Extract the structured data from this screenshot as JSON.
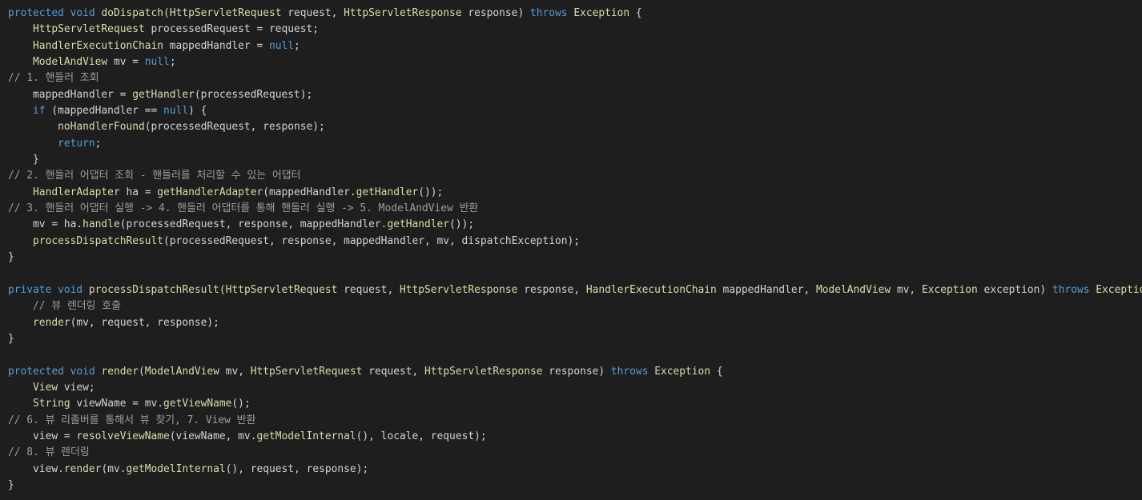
{
  "colors": {
    "background": "#1e1e1e",
    "keyword": "#569cd6",
    "type": "#dcdcaa",
    "method": "#dcdcaa",
    "text": "#d4d4d4",
    "comment": "#9e9e9e"
  },
  "code": {
    "lines": [
      [
        [
          "kw",
          "protected"
        ],
        [
          "t",
          " "
        ],
        [
          "kw",
          "void"
        ],
        [
          "t",
          " "
        ],
        [
          "fn",
          "doDispatch"
        ],
        [
          "t",
          "("
        ],
        [
          "ty",
          "HttpServletRequest"
        ],
        [
          "t",
          " request, "
        ],
        [
          "ty",
          "HttpServletResponse"
        ],
        [
          "t",
          " response) "
        ],
        [
          "kw",
          "throws"
        ],
        [
          "t",
          " "
        ],
        [
          "ty",
          "Exception"
        ],
        [
          "t",
          " {"
        ]
      ],
      [
        [
          "t",
          "    "
        ],
        [
          "ty",
          "HttpServletRequest"
        ],
        [
          "t",
          " processedRequest = request;"
        ]
      ],
      [
        [
          "t",
          "    "
        ],
        [
          "ty",
          "HandlerExecutionChain"
        ],
        [
          "t",
          " mappedHandler = "
        ],
        [
          "kw",
          "null"
        ],
        [
          "t",
          ";"
        ]
      ],
      [
        [
          "t",
          "    "
        ],
        [
          "ty",
          "ModelAndView"
        ],
        [
          "t",
          " mv = "
        ],
        [
          "kw",
          "null"
        ],
        [
          "t",
          ";"
        ]
      ],
      [
        [
          "cm",
          "// 1. 핸들러 조회"
        ]
      ],
      [
        [
          "t",
          "    mappedHandler = "
        ],
        [
          "fn",
          "getHandler"
        ],
        [
          "t",
          "(processedRequest);"
        ]
      ],
      [
        [
          "t",
          "    "
        ],
        [
          "kw",
          "if"
        ],
        [
          "t",
          " (mappedHandler == "
        ],
        [
          "kw",
          "null"
        ],
        [
          "t",
          ") {"
        ]
      ],
      [
        [
          "t",
          "        "
        ],
        [
          "fn",
          "noHandlerFound"
        ],
        [
          "t",
          "(processedRequest, response);"
        ]
      ],
      [
        [
          "t",
          "        "
        ],
        [
          "kw",
          "return"
        ],
        [
          "t",
          ";"
        ]
      ],
      [
        [
          "t",
          "    }"
        ]
      ],
      [
        [
          "cm",
          "// 2. 핸들러 어댑터 조회 - 핸들러를 처리할 수 있는 어댑터"
        ]
      ],
      [
        [
          "t",
          "    "
        ],
        [
          "ty",
          "HandlerAdapter"
        ],
        [
          "t",
          " ha = "
        ],
        [
          "fn",
          "getHandlerAdapter"
        ],
        [
          "t",
          "(mappedHandler."
        ],
        [
          "fn",
          "getHandler"
        ],
        [
          "t",
          "());"
        ]
      ],
      [
        [
          "cm",
          "// 3. 핸들러 어댑터 실행 -> 4. 핸들러 어댑터를 통해 핸들러 실행 -> 5. ModelAndView 반환"
        ]
      ],
      [
        [
          "t",
          "    mv = ha."
        ],
        [
          "fn",
          "handle"
        ],
        [
          "t",
          "(processedRequest, response, mappedHandler."
        ],
        [
          "fn",
          "getHandler"
        ],
        [
          "t",
          "());"
        ]
      ],
      [
        [
          "t",
          "    "
        ],
        [
          "fn",
          "processDispatchResult"
        ],
        [
          "t",
          "(processedRequest, response, mappedHandler, mv, dispatchException);"
        ]
      ],
      [
        [
          "t",
          "}"
        ]
      ],
      [
        [
          "t",
          ""
        ]
      ],
      [
        [
          "kw",
          "private"
        ],
        [
          "t",
          " "
        ],
        [
          "kw",
          "void"
        ],
        [
          "t",
          " "
        ],
        [
          "fn",
          "processDispatchResult"
        ],
        [
          "t",
          "("
        ],
        [
          "ty",
          "HttpServletRequest"
        ],
        [
          "t",
          " request, "
        ],
        [
          "ty",
          "HttpServletResponse"
        ],
        [
          "t",
          " response, "
        ],
        [
          "ty",
          "HandlerExecutionChain"
        ],
        [
          "t",
          " mappedHandler, "
        ],
        [
          "ty",
          "ModelAndView"
        ],
        [
          "t",
          " mv, "
        ],
        [
          "ty",
          "Exception"
        ],
        [
          "t",
          " exception) "
        ],
        [
          "kw",
          "throws"
        ],
        [
          "t",
          " "
        ],
        [
          "ty",
          "Exception"
        ],
        [
          "t",
          " {"
        ]
      ],
      [
        [
          "t",
          "    "
        ],
        [
          "cm",
          "// 뷰 렌더링 호출"
        ]
      ],
      [
        [
          "t",
          "    "
        ],
        [
          "fn",
          "render"
        ],
        [
          "t",
          "(mv, request, response);"
        ]
      ],
      [
        [
          "t",
          "}"
        ]
      ],
      [
        [
          "t",
          ""
        ]
      ],
      [
        [
          "kw",
          "protected"
        ],
        [
          "t",
          " "
        ],
        [
          "kw",
          "void"
        ],
        [
          "t",
          " "
        ],
        [
          "fn",
          "render"
        ],
        [
          "t",
          "("
        ],
        [
          "ty",
          "ModelAndView"
        ],
        [
          "t",
          " mv, "
        ],
        [
          "ty",
          "HttpServletRequest"
        ],
        [
          "t",
          " request, "
        ],
        [
          "ty",
          "HttpServletResponse"
        ],
        [
          "t",
          " response) "
        ],
        [
          "kw",
          "throws"
        ],
        [
          "t",
          " "
        ],
        [
          "ty",
          "Exception"
        ],
        [
          "t",
          " {"
        ]
      ],
      [
        [
          "t",
          "    "
        ],
        [
          "ty",
          "View"
        ],
        [
          "t",
          " view;"
        ]
      ],
      [
        [
          "t",
          "    "
        ],
        [
          "ty",
          "String"
        ],
        [
          "t",
          " viewName = mv."
        ],
        [
          "fn",
          "getViewName"
        ],
        [
          "t",
          "();"
        ]
      ],
      [
        [
          "cm",
          "// 6. 뷰 리졸버를 통해서 뷰 찾기, 7. View 반환"
        ]
      ],
      [
        [
          "t",
          "    view = "
        ],
        [
          "fn",
          "resolveViewName"
        ],
        [
          "t",
          "(viewName, mv."
        ],
        [
          "fn",
          "getModelInternal"
        ],
        [
          "t",
          "(), locale, request);"
        ]
      ],
      [
        [
          "cm",
          "// 8. 뷰 렌더링"
        ]
      ],
      [
        [
          "t",
          "    view."
        ],
        [
          "fn",
          "render"
        ],
        [
          "t",
          "(mv."
        ],
        [
          "fn",
          "getModelInternal"
        ],
        [
          "t",
          "(), request, response);"
        ]
      ],
      [
        [
          "t",
          "}"
        ]
      ]
    ]
  }
}
